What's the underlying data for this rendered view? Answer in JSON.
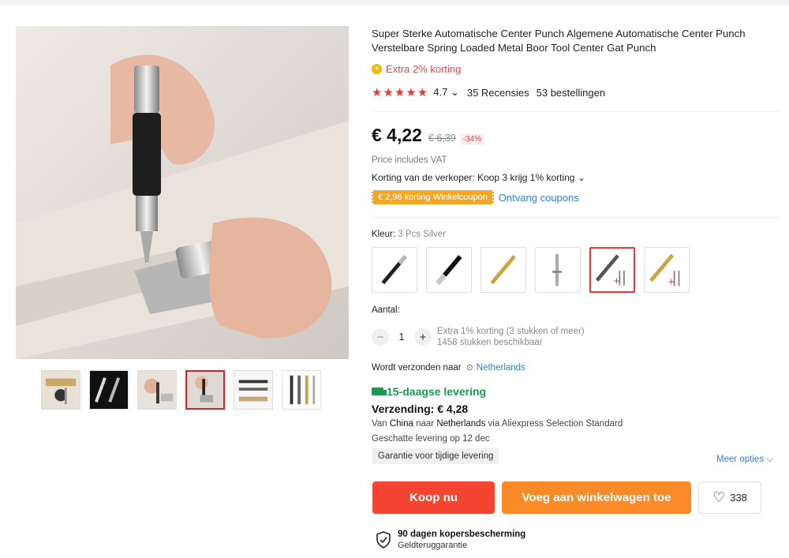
{
  "product": {
    "title": "Super Sterke Automatische Center Punch Algemene Automatische Center Punch Verstelbare Spring Loaded Metal Boor Tool Center Gat Punch",
    "extra_discount": "Extra 2% korting",
    "stars": "★★★★★",
    "rating": "4.7",
    "reviews": "35 Recensies",
    "orders": "53 bestellingen"
  },
  "price": {
    "current": "€ 4,22",
    "original": "€ 6,39",
    "discount": "-34%",
    "vat_note": "Price includes VAT",
    "seller_discount": "Korting van de verkoper: Koop 3 krijg 1% korting",
    "coupon": "€ 2,96 korting Winkelcoupon",
    "get_coupons": "Ontvang coupons"
  },
  "color": {
    "label": "Kleur:",
    "selected": "3 Pcs Silver",
    "variants": [
      "black-pen",
      "black-pen-2",
      "gold-pen",
      "silver-pen",
      "3-pcs-silver",
      "3-pcs-gold"
    ],
    "selected_index": 4
  },
  "quantity": {
    "label": "Aantal:",
    "value": "1",
    "extra": "Extra 1% korting (3 stukken of meer)",
    "available": "1458 stukken beschikbaar"
  },
  "shipping": {
    "ships_to_label": "Wordt verzonden naar",
    "country": "Netherlands",
    "delivery": "15-daagse levering",
    "cost": "Verzending: € 4,28",
    "from_prefix": "Van",
    "from_country": "China",
    "to_word": "naar",
    "to_country": "Netherlands",
    "method": "via Aliexpress Selection Standard",
    "estimate": "Geschatte levering op 12 dec",
    "guarantee": "Garantie voor tijdige levering",
    "more": "Meer opties"
  },
  "actions": {
    "buy": "Koop nu",
    "cart": "Voeg aan winkelwagen toe",
    "wishlist_count": "338"
  },
  "protection": {
    "title": "90 dagen kopersbescherming",
    "subtitle": "Geldteruggarantie"
  },
  "colors": {
    "buy": "#f34531",
    "cart": "#fa8a27",
    "accent_red": "#e53935",
    "link": "#2b7dd6",
    "delivery_green": "#1a9a53",
    "coupon": "#f5a623"
  }
}
